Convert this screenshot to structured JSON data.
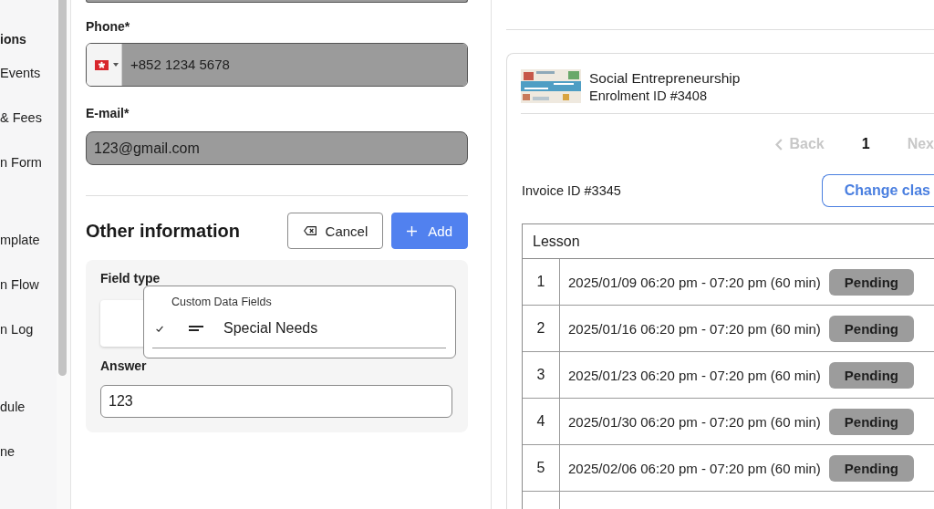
{
  "sidebar": {
    "groups": [
      {
        "header": "ions",
        "items": [
          {
            "label": "Events"
          },
          {
            "label": "& Fees"
          },
          {
            "label": "n Form"
          }
        ]
      },
      {
        "items": [
          {
            "label": "mplate"
          },
          {
            "label": "n Flow"
          },
          {
            "label": "n Log"
          }
        ]
      },
      {
        "items": [
          {
            "label": "dule"
          },
          {
            "label": "ne"
          }
        ]
      }
    ]
  },
  "contact_form": {
    "fields": [
      {
        "label": "Phone*",
        "kind": "phone",
        "value": "+852 1234 5678",
        "disabled": true
      },
      {
        "label": "E-mail*",
        "kind": "email",
        "value": "123@gmail.com",
        "disabled": true
      }
    ]
  },
  "other_information": {
    "title": "Other information",
    "buttons": [
      {
        "label": "Cancel",
        "kind": "cancel"
      },
      {
        "label": "Add",
        "kind": "add"
      }
    ],
    "field_type": {
      "label": "Field type",
      "expanded": true,
      "menu": {
        "group": "Custom Data Fields",
        "items": [
          {
            "label": "Special Needs",
            "selected": true
          }
        ]
      }
    },
    "answer": {
      "label": "Answer",
      "value": "123"
    }
  },
  "enrolment": {
    "course_title": "Social Entrepreneurship",
    "enrolment_id": "Enrolment ID #3408",
    "pagination": {
      "back": {
        "label": "Back",
        "disabled": true
      },
      "pages": [
        {
          "label": "1",
          "selected": true
        }
      ],
      "next": {
        "label": "Nex",
        "disabled": true
      }
    },
    "invoice_id": "Invoice ID #3345",
    "change_class_button": {
      "label": "Change clas"
    },
    "table": {
      "columns": [
        "Lesson"
      ],
      "rows": [
        {
          "number": "1",
          "time": "2025/01/09 06:20 pm - 07:20 pm (60 min)",
          "status": "Pending"
        },
        {
          "number": "2",
          "time": "2025/01/16 06:20 pm - 07:20 pm (60 min)",
          "status": "Pending"
        },
        {
          "number": "3",
          "time": "2025/01/23 06:20 pm - 07:20 pm (60 min)",
          "status": "Pending"
        },
        {
          "number": "4",
          "time": "2025/01/30 06:20 pm - 07:20 pm (60 min)",
          "status": "Pending"
        },
        {
          "number": "5",
          "time": "2025/02/06 06:20 pm - 07:20 pm (60 min)",
          "status": "Pending"
        }
      ]
    }
  }
}
